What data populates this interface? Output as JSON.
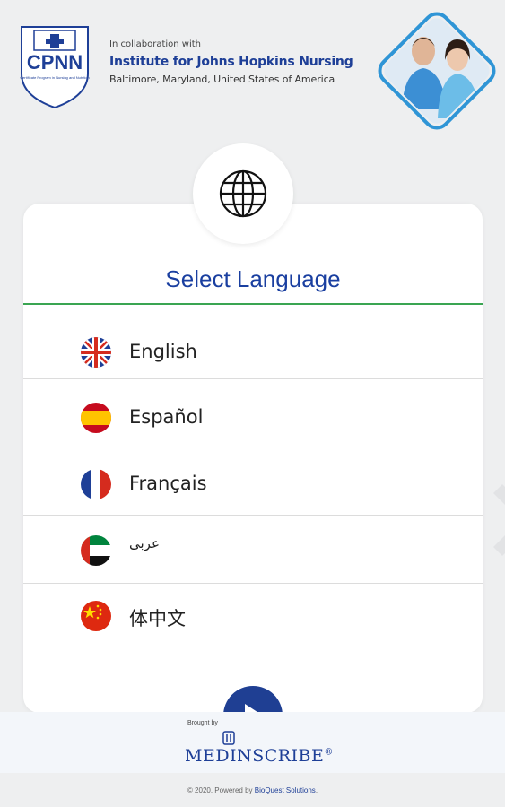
{
  "header": {
    "logo_text": "CPNN",
    "logo_subtext": "Certificate Program in Nursing and Nutrition",
    "collaboration": "In collaboration with",
    "institute": "Institute for Johns Hopkins Nursing",
    "location": "Baltimore, Maryland, United States of America"
  },
  "card": {
    "title": "Select Language",
    "globe_icon": "globe-icon",
    "languages": [
      {
        "label": "English",
        "flag": "uk-flag-icon"
      },
      {
        "label": "Español",
        "flag": "spain-flag-icon"
      },
      {
        "label": "Français",
        "flag": "france-flag-icon"
      },
      {
        "label": "عربى",
        "flag": "uae-flag-icon"
      },
      {
        "label": "体中文",
        "flag": "china-flag-icon"
      }
    ],
    "next_icon": "arrow-right-icon"
  },
  "footer": {
    "brought_by": "Brought by",
    "brand": "MEDINSCRIBE",
    "brand_mark": "®",
    "copyright_prefix": "© 2020. Powered by ",
    "powered_by": "BioQuest Solutions",
    "copyright_suffix": "."
  },
  "colors": {
    "primary": "#1e3f97",
    "accent_green": "#3aa552",
    "background": "#eeeff0"
  }
}
